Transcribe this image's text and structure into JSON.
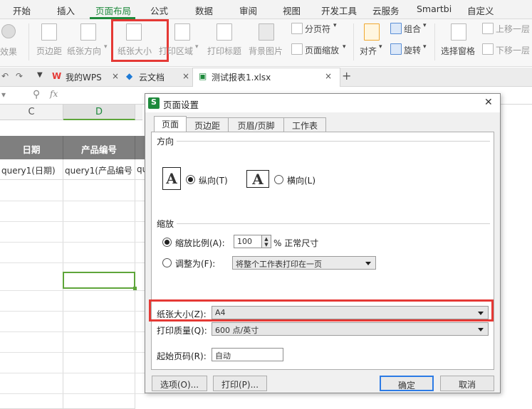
{
  "menubar": {
    "items": [
      "开始",
      "插入",
      "页面布局",
      "公式",
      "数据",
      "审阅",
      "视图",
      "开发工具",
      "云服务",
      "Smartbi",
      "自定义"
    ],
    "active_index": 2,
    "accent": "#1e8a3c"
  },
  "ribbon": {
    "effect_label": "效果",
    "margins_label": "页边距",
    "orientation_label": "纸张方向",
    "paper_size_label": "纸张大小",
    "print_area_label": "打印区域",
    "print_titles_label": "打印标题",
    "background_label": "背景图片",
    "page_break_label": "分页符",
    "page_zoom_label": "页面缩放",
    "align_label": "对齐",
    "group_label": "组合",
    "rotate_label": "旋转",
    "selection_pane_label": "选择窗格",
    "bring_forward_label": "上移一层",
    "send_backward_label": "下移一层"
  },
  "tabs": {
    "wps_label": "我的WPS",
    "cloud_label": "云文档",
    "file_label": "测试报表1.xlsx",
    "close_glyph": "×",
    "add_glyph": "+"
  },
  "formula_bar": {
    "fx": "fx"
  },
  "grid": {
    "col_c": "C",
    "col_d": "D",
    "header_date": "日期",
    "header_product": "产品编号",
    "cell_date": "query1(日期)",
    "cell_product": "query1(产品编号",
    "cell_next": "qu",
    "selected_color": "#5ea53a"
  },
  "dialog": {
    "title": "页面设置",
    "close_glyph": "✕",
    "tabs": [
      "页面",
      "页边距",
      "页眉/页脚",
      "工作表"
    ],
    "orientation_group": "方向",
    "portrait_label": "纵向(T)",
    "landscape_label": "横向(L)",
    "scale_group": "缩放",
    "scale_ratio_label": "缩放比例(A):",
    "scale_value": "100",
    "scale_unit": "% 正常尺寸",
    "fit_to_label": "调整为(F):",
    "fit_to_value": "将整个工作表打印在一页",
    "paper_size_label": "纸张大小(Z):",
    "paper_size_value": "A4",
    "print_quality_label": "打印质量(Q):",
    "print_quality_value": "600 点/英寸",
    "first_page_label": "起始页码(R):",
    "first_page_value": "自动",
    "options_button": "选项(O)...",
    "print_button": "打印(P)...",
    "ok_button": "确定",
    "cancel_button": "取消"
  }
}
